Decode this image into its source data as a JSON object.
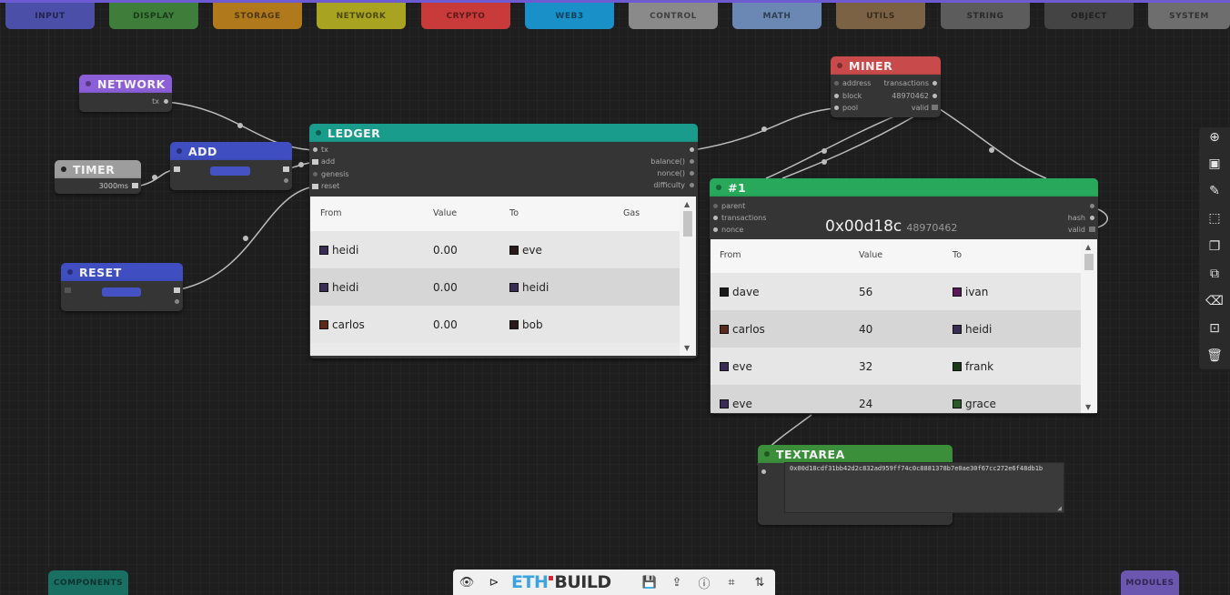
{
  "tabs": [
    {
      "label": "INPUT",
      "color": "#4b4fa8"
    },
    {
      "label": "DISPLAY",
      "color": "#3e7e3a"
    },
    {
      "label": "STORAGE",
      "color": "#b07a1c"
    },
    {
      "label": "NETWORK",
      "color": "#a8a320"
    },
    {
      "label": "CRYPTO",
      "color": "#c93b3b"
    },
    {
      "label": "WEB3",
      "color": "#1a90c9"
    },
    {
      "label": "CONTROL",
      "color": "#8a8a8a"
    },
    {
      "label": "MATH",
      "color": "#6a88b3"
    },
    {
      "label": "UTILS",
      "color": "#7b6244"
    },
    {
      "label": "STRING",
      "color": "#5c5c5c"
    },
    {
      "label": "OBJECT",
      "color": "#444444"
    },
    {
      "label": "SYSTEM",
      "color": "#6e6e6e"
    }
  ],
  "nodes": {
    "network": {
      "title": "NETWORK",
      "color": "#8c5ed8",
      "out": "tx"
    },
    "timer": {
      "title": "TIMER",
      "color": "#9d9d9d",
      "value": "3000ms"
    },
    "add": {
      "title": "ADD",
      "color": "#3f4ec0"
    },
    "reset": {
      "title": "RESET",
      "color": "#3f4ec0"
    },
    "ledger": {
      "title": "LEDGER",
      "color": "#1a9c8c",
      "inputs": [
        "tx",
        "add",
        "genesis",
        "reset"
      ],
      "outputs": [
        "balance()",
        "nonce()",
        "difficulty"
      ],
      "columns": [
        "From",
        "Value",
        "To",
        "Gas"
      ],
      "rows": [
        {
          "from": "heidi",
          "value": "0.00",
          "to": "eve",
          "gas": ""
        },
        {
          "from": "heidi",
          "value": "0.00",
          "to": "heidi",
          "gas": ""
        },
        {
          "from": "carlos",
          "value": "0.00",
          "to": "bob",
          "gas": ""
        }
      ]
    },
    "miner": {
      "title": "MINER",
      "color": "#c94a4a",
      "inputs": [
        "address",
        "block",
        "pool"
      ],
      "outputs": [
        "transactions",
        "48970462",
        "valid"
      ]
    },
    "block": {
      "title": "#1",
      "color": "#27a85a",
      "inputs": [
        "parent",
        "transactions",
        "nonce"
      ],
      "outputs": [
        "hash",
        "valid"
      ],
      "hash": "0x00d18c",
      "nonce": "48970462",
      "columns": [
        "From",
        "Value",
        "To"
      ],
      "rows": [
        {
          "from": "dave",
          "value": "56",
          "to": "ivan"
        },
        {
          "from": "carlos",
          "value": "40",
          "to": "heidi"
        },
        {
          "from": "eve",
          "value": "32",
          "to": "frank"
        },
        {
          "from": "eve",
          "value": "24",
          "to": "grace"
        }
      ]
    },
    "textarea": {
      "title": "TEXTAREA",
      "color": "#3b8f3b",
      "value": "0x00d18cdf31bb42d2c832ad959ff74c0c8881378b7e0ae30f67cc272e6f48db1b"
    }
  },
  "right_tools": [
    "add-circle-icon",
    "image-icon",
    "pencil-icon",
    "select-box-icon",
    "copy-icon",
    "duplicate-icon",
    "backspace-icon",
    "group-icon",
    "trash-icon"
  ],
  "bottom": {
    "components": "COMPONENTS",
    "modules": "MODULES",
    "logo_left": "ETH",
    "logo_right": "BUILD"
  }
}
